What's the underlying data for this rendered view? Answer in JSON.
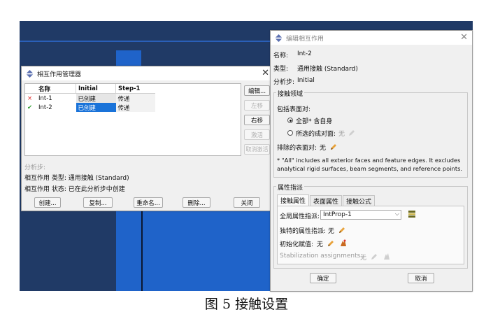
{
  "manager": {
    "title": "相互作用管理器",
    "columns": [
      "名称",
      "Initial",
      "Step-1"
    ],
    "rows": [
      {
        "status": "×",
        "name": "Int-1",
        "initial": "已创建",
        "step1": "传递"
      },
      {
        "status": "✔",
        "name": "Int-2",
        "initial": "已创建",
        "step1": "传递"
      }
    ],
    "side_buttons": {
      "edit": "编辑...",
      "left": "左移",
      "right": "右移",
      "activate": "激活",
      "deactivate": "取消激活"
    },
    "info": {
      "step_label": "分析步:",
      "type_line": "相互作用 类型: 通用接触 (Standard)",
      "state_line": "相互作用 状态: 已在此分析步中创建"
    },
    "bottom_buttons": {
      "create": "创建...",
      "copy": "复制...",
      "rename": "重命名...",
      "delete": "删除...",
      "close": "关闭"
    }
  },
  "editor": {
    "title": "编辑相互作用",
    "name_label": "名称:",
    "name_value": "Int-2",
    "type_label": "类型:",
    "type_value": "通用接触 (Standard)",
    "step_label": "分析步:",
    "step_value": "Initial",
    "contact_domain": {
      "title": "接触领域",
      "include_label": "包括表面对:",
      "opt_all": "全部* 含自身",
      "opt_selected": "所选的成对面:",
      "opt_selected_value": "无",
      "exclude_label": "排除的表面对:",
      "exclude_value": "无",
      "note_line1": "* \"All\" includes all exterior faces and feature edges. It excludes",
      "note_line2": "analytical rigid surfaces, beam segments, and reference points."
    },
    "property": {
      "title": "属性指派",
      "tabs": [
        "接触属性",
        "表面属性",
        "接触公式"
      ],
      "global_label": "全局属性指派:",
      "global_value": "IntProp-1",
      "unique_label": "独特的属性指派:",
      "unique_value": "无",
      "init_label": "初始化赋值:",
      "init_value": "无",
      "stab_label": "Stabilization assignments:",
      "stab_value": "无"
    },
    "ok": "确定",
    "cancel": "取消"
  },
  "caption": "图 5  接触设置"
}
